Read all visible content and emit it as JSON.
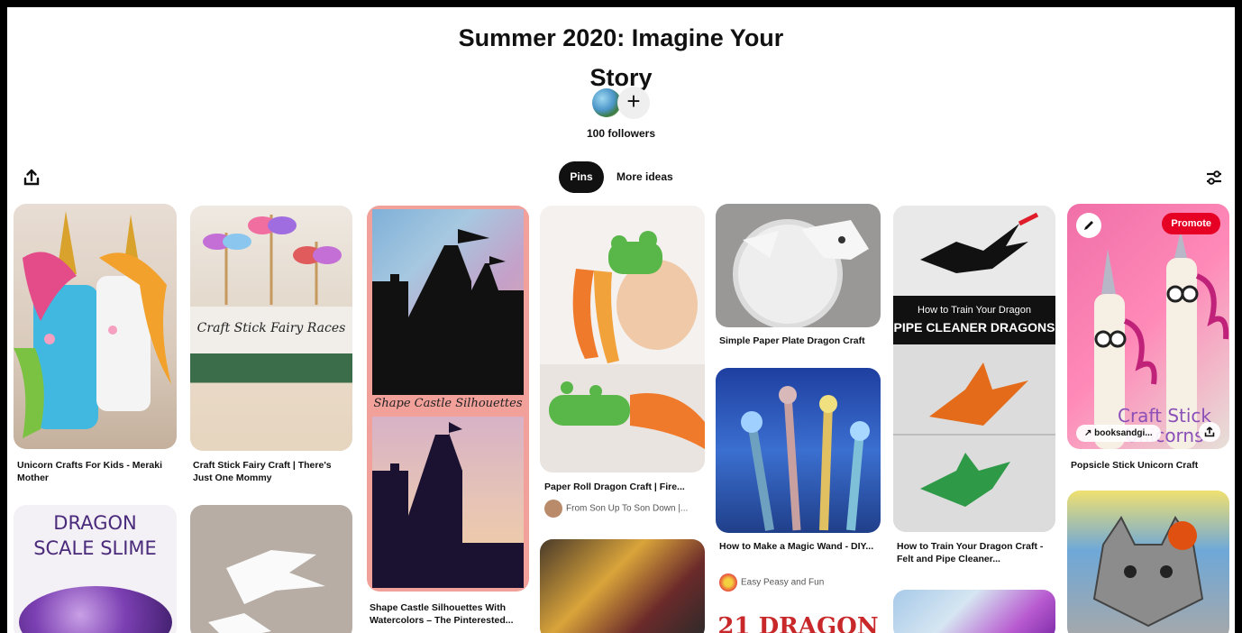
{
  "board": {
    "title_line1": "Summer 2020: Imagine Your",
    "title_line2": "Story",
    "followers": "100 followers",
    "add_collaborator": "+"
  },
  "tabs": {
    "pins": "Pins",
    "more_ideas": "More ideas"
  },
  "icons": {
    "share": "share-icon",
    "filter": "filter-icon",
    "edit": "pencil-icon",
    "link": "arrow-icon"
  },
  "colors": {
    "accent": "#e60023",
    "tab_active": "#111111"
  },
  "pins": {
    "unicorn_crafts": {
      "title": "Unicorn Crafts For Kids - Meraki Mother"
    },
    "fairy_races": {
      "title": "Craft Stick Fairy Craft | There's Just One Mommy",
      "overlay": "Craft Stick Fairy Races"
    },
    "dragon_slime": {
      "overlay": "DRAGON SCALE SLIME"
    },
    "castle": {
      "title": "Shape Castle Silhouettes With Watercolors – The Pinterested...",
      "overlay": "Shape Castle Silhouettes"
    },
    "paper_roll_dragon": {
      "title": "Paper Roll Dragon Craft | Fire...",
      "source": "From Son Up To Son Down |..."
    },
    "paper_plate_dragon": {
      "title": "Simple Paper Plate Dragon Craft"
    },
    "magic_wand": {
      "title": "How to Make a Magic Wand - DIY...",
      "source": "Easy Peasy and Fun"
    },
    "dragon_21": {
      "overlay": "21 DRAGON"
    },
    "train_dragon": {
      "title": "How to Train Your Dragon Craft - Felt and Pipe Cleaner...",
      "overlay1": "How to Train Your Dragon",
      "overlay2": "PIPE CLEANER DRAGONS"
    },
    "unicorn_sticks": {
      "title": "Popsicle Stick Unicorn Craft",
      "promote": "Promote",
      "link_label": "booksandgi...",
      "overlay": "Craft Stick Unicorns"
    }
  }
}
